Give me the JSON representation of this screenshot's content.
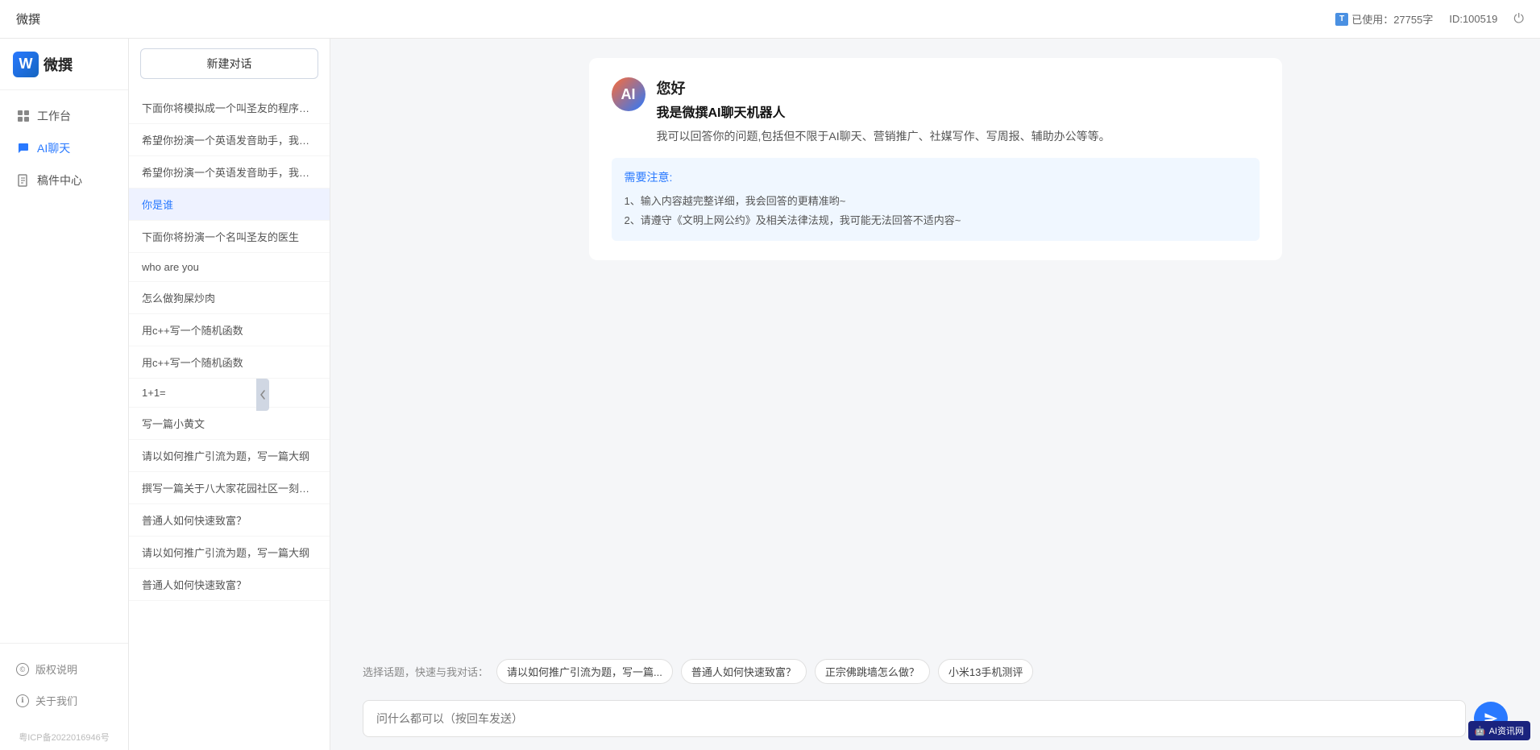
{
  "topbar": {
    "title": "微撰",
    "usage_icon": "T",
    "usage_label": "已使用：27755字",
    "user_id": "ID:100519"
  },
  "logo": {
    "icon": "W",
    "text": "微撰"
  },
  "nav": {
    "items": [
      {
        "id": "workbench",
        "label": "工作台",
        "icon": "⊞"
      },
      {
        "id": "ai-chat",
        "label": "AI聊天",
        "icon": "💬",
        "active": true
      },
      {
        "id": "draft-center",
        "label": "稿件中心",
        "icon": "📄"
      }
    ],
    "bottom_items": [
      {
        "id": "copyright",
        "label": "版权说明",
        "icon": "©"
      },
      {
        "id": "about",
        "label": "关于我们",
        "icon": "ℹ"
      }
    ],
    "icp": "粤ICP备2022016946号"
  },
  "history": {
    "new_chat_label": "新建对话",
    "items": [
      {
        "id": 1,
        "text": "下面你将模拟成一个叫圣友的程序员，我说..."
      },
      {
        "id": 2,
        "text": "希望你扮演一个英语发音助手，我提供给你..."
      },
      {
        "id": 3,
        "text": "希望你扮演一个英语发音助手，我提供给你..."
      },
      {
        "id": 4,
        "text": "你是谁",
        "active": true
      },
      {
        "id": 5,
        "text": "下面你将扮演一个名叫圣友的医生"
      },
      {
        "id": 6,
        "text": "who are you"
      },
      {
        "id": 7,
        "text": "怎么做狗屎炒肉"
      },
      {
        "id": 8,
        "text": "用c++写一个随机函数"
      },
      {
        "id": 9,
        "text": "用c++写一个随机函数"
      },
      {
        "id": 10,
        "text": "1+1="
      },
      {
        "id": 11,
        "text": "写一篇小黄文"
      },
      {
        "id": 12,
        "text": "请以如何推广引流为题，写一篇大纲"
      },
      {
        "id": 13,
        "text": "撰写一篇关于八大家花园社区一刻钟便民生..."
      },
      {
        "id": 14,
        "text": "普通人如何快速致富？"
      },
      {
        "id": 15,
        "text": "请以如何推广引流为题，写一篇大纲"
      },
      {
        "id": 16,
        "text": "普通人如何快速致富？"
      }
    ]
  },
  "welcome": {
    "greeting": "您好",
    "bot_name": "我是微撰AI聊天机器人",
    "description": "我可以回答你的问题,包括但不限于AI聊天、营销推广、社媒写作、写周报、辅助办公等等。",
    "notice_title": "需要注意:",
    "notice_items": [
      "1、输入内容越完整详细，我会回答的更精准哟~",
      "2、请遵守《文明上网公约》及相关法律法规，我可能无法回答不适内容~"
    ]
  },
  "quick_topics": {
    "label": "选择话题，快速与我对话：",
    "chips": [
      "请以如何推广引流为题，写一篇...",
      "普通人如何快速致富？",
      "正宗佛跳墙怎么做？",
      "小米13手机测评"
    ]
  },
  "input": {
    "placeholder": "问什么都可以（按回车发送）"
  },
  "ai_badge": {
    "icon": "🤖",
    "text": "AI资讯网"
  }
}
